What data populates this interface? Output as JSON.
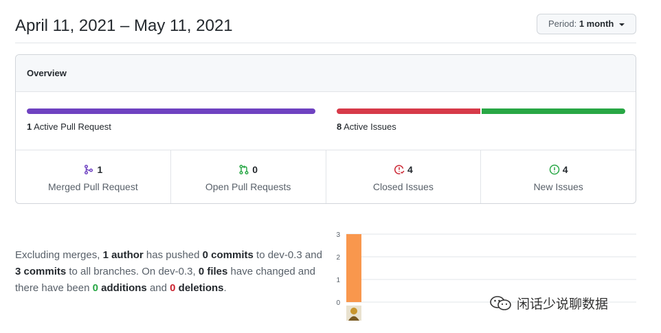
{
  "header": {
    "date_range": "April 11, 2021 – May 11, 2021",
    "period_prefix": "Period:",
    "period_value": "1 month"
  },
  "overview": {
    "title": "Overview",
    "pull_requests": {
      "count": "1",
      "text": "Active Pull Request",
      "color": "#6f42c1"
    },
    "issues": {
      "count": "8",
      "text": "Active Issues",
      "closed_fraction": 0.5,
      "closed_color": "#d73a49",
      "new_color": "#28a745"
    },
    "stats": [
      {
        "icon": "git-merge-icon",
        "count": "1",
        "label": "Merged Pull Request",
        "color": "#6f42c1"
      },
      {
        "icon": "git-pull-request-icon",
        "count": "0",
        "label": "Open Pull Requests",
        "color": "#28a745"
      },
      {
        "icon": "issue-closed-icon",
        "count": "4",
        "label": "Closed Issues",
        "color": "#cb2431"
      },
      {
        "icon": "issue-opened-icon",
        "count": "4",
        "label": "New Issues",
        "color": "#28a745"
      }
    ]
  },
  "summary": {
    "t1": "Excluding merges, ",
    "authors": "1 author",
    "t2": " has pushed ",
    "commits_branch": "0 commits",
    "t3": " to dev-0.3 and ",
    "commits_all": "3 commits",
    "t4": " to all branches. On dev-0.3, ",
    "files": "0 files",
    "t5": " have changed and there have been ",
    "additions_n": "0",
    "additions_w": " additions",
    "t6": " and ",
    "deletions_n": "0",
    "deletions_w": " deletions",
    "t7": "."
  },
  "chart_data": {
    "type": "bar",
    "categories": [
      "author"
    ],
    "values": [
      3
    ],
    "ylim": [
      0,
      3
    ],
    "yticks": [
      "0",
      "1",
      "2",
      "3"
    ],
    "grid": true,
    "bar_color": "#f9974d"
  },
  "watermark": {
    "text": "闲话少说聊数据",
    "icon": "wechat-icon"
  }
}
